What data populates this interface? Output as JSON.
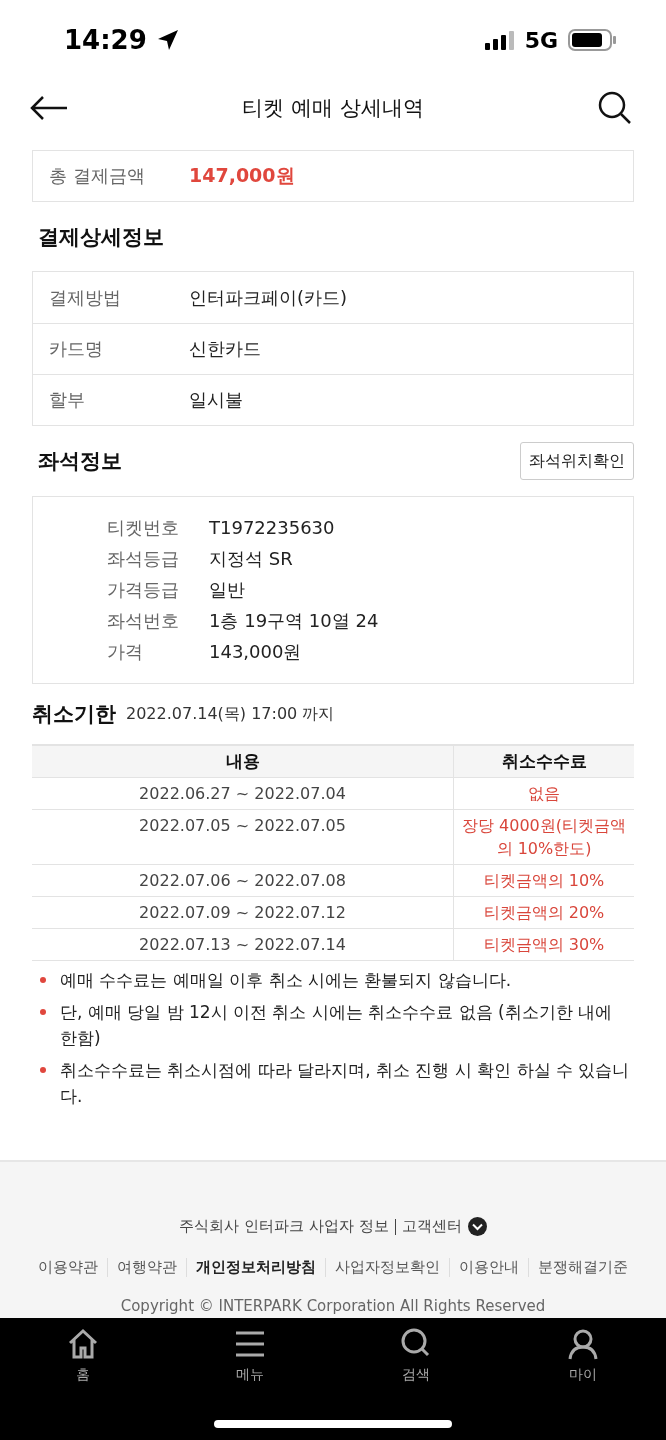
{
  "status_bar": {
    "time": "14:29",
    "network": "5G"
  },
  "header": {
    "title": "티켓 예매 상세내역"
  },
  "total": {
    "label": "총 결제금액",
    "amount": "147,000원"
  },
  "payment": {
    "title": "결제상세정보",
    "rows": [
      {
        "label": "결제방법",
        "value": "인터파크페이(카드)"
      },
      {
        "label": "카드명",
        "value": "신한카드"
      },
      {
        "label": "할부",
        "value": "일시불"
      }
    ]
  },
  "seat": {
    "title": "좌석정보",
    "button": "좌석위치확인",
    "rows": [
      {
        "label": "티켓번호",
        "value": "T1972235630"
      },
      {
        "label": "좌석등급",
        "value": "지정석 SR"
      },
      {
        "label": "가격등급",
        "value": "일반"
      },
      {
        "label": "좌석번호",
        "value": "1층 19구역 10열 24"
      },
      {
        "label": "가격",
        "value": "143,000원"
      }
    ]
  },
  "cancel": {
    "title": "취소기한",
    "deadline": "2022.07.14(목) 17:00 까지",
    "columns": [
      "내용",
      "취소수수료"
    ],
    "rows": [
      {
        "period": "2022.06.27 ~ 2022.07.04",
        "fee": "없음"
      },
      {
        "period": "2022.07.05 ~ 2022.07.05",
        "fee": "장당 4000원(티켓금액의 10%한도)"
      },
      {
        "period": "2022.07.06 ~ 2022.07.08",
        "fee": "티켓금액의 10%"
      },
      {
        "period": "2022.07.09 ~ 2022.07.12",
        "fee": "티켓금액의 20%"
      },
      {
        "period": "2022.07.13 ~ 2022.07.14",
        "fee": "티켓금액의 30%"
      }
    ],
    "notes": [
      "예매 수수료는 예매일 이후 취소 시에는 환불되지 않습니다.",
      "단, 예매 당일 밤 12시 이전 취소 시에는 취소수수료 없음 (취소기한 내에 한함)",
      "취소수수료는 취소시점에 따라 달라지며, 취소 진행 시 확인 하실 수 있습니다."
    ]
  },
  "footer": {
    "company": "주식회사 인터파크 사업자 정보",
    "support": "고객센터",
    "links": [
      {
        "label": "이용약관",
        "emphasized": false
      },
      {
        "label": "여행약관",
        "emphasized": false
      },
      {
        "label": "개인정보처리방침",
        "emphasized": true
      },
      {
        "label": "사업자정보확인",
        "emphasized": false
      },
      {
        "label": "이용안내",
        "emphasized": false
      },
      {
        "label": "분쟁해결기준",
        "emphasized": false
      }
    ],
    "copyright": "Copyright © INTERPARK Corporation All Rights Reserved"
  },
  "nav": [
    {
      "kind": "home",
      "label": "홈"
    },
    {
      "kind": "menu",
      "label": "메뉴"
    },
    {
      "kind": "search",
      "label": "검색"
    },
    {
      "kind": "my",
      "label": "마이"
    }
  ]
}
